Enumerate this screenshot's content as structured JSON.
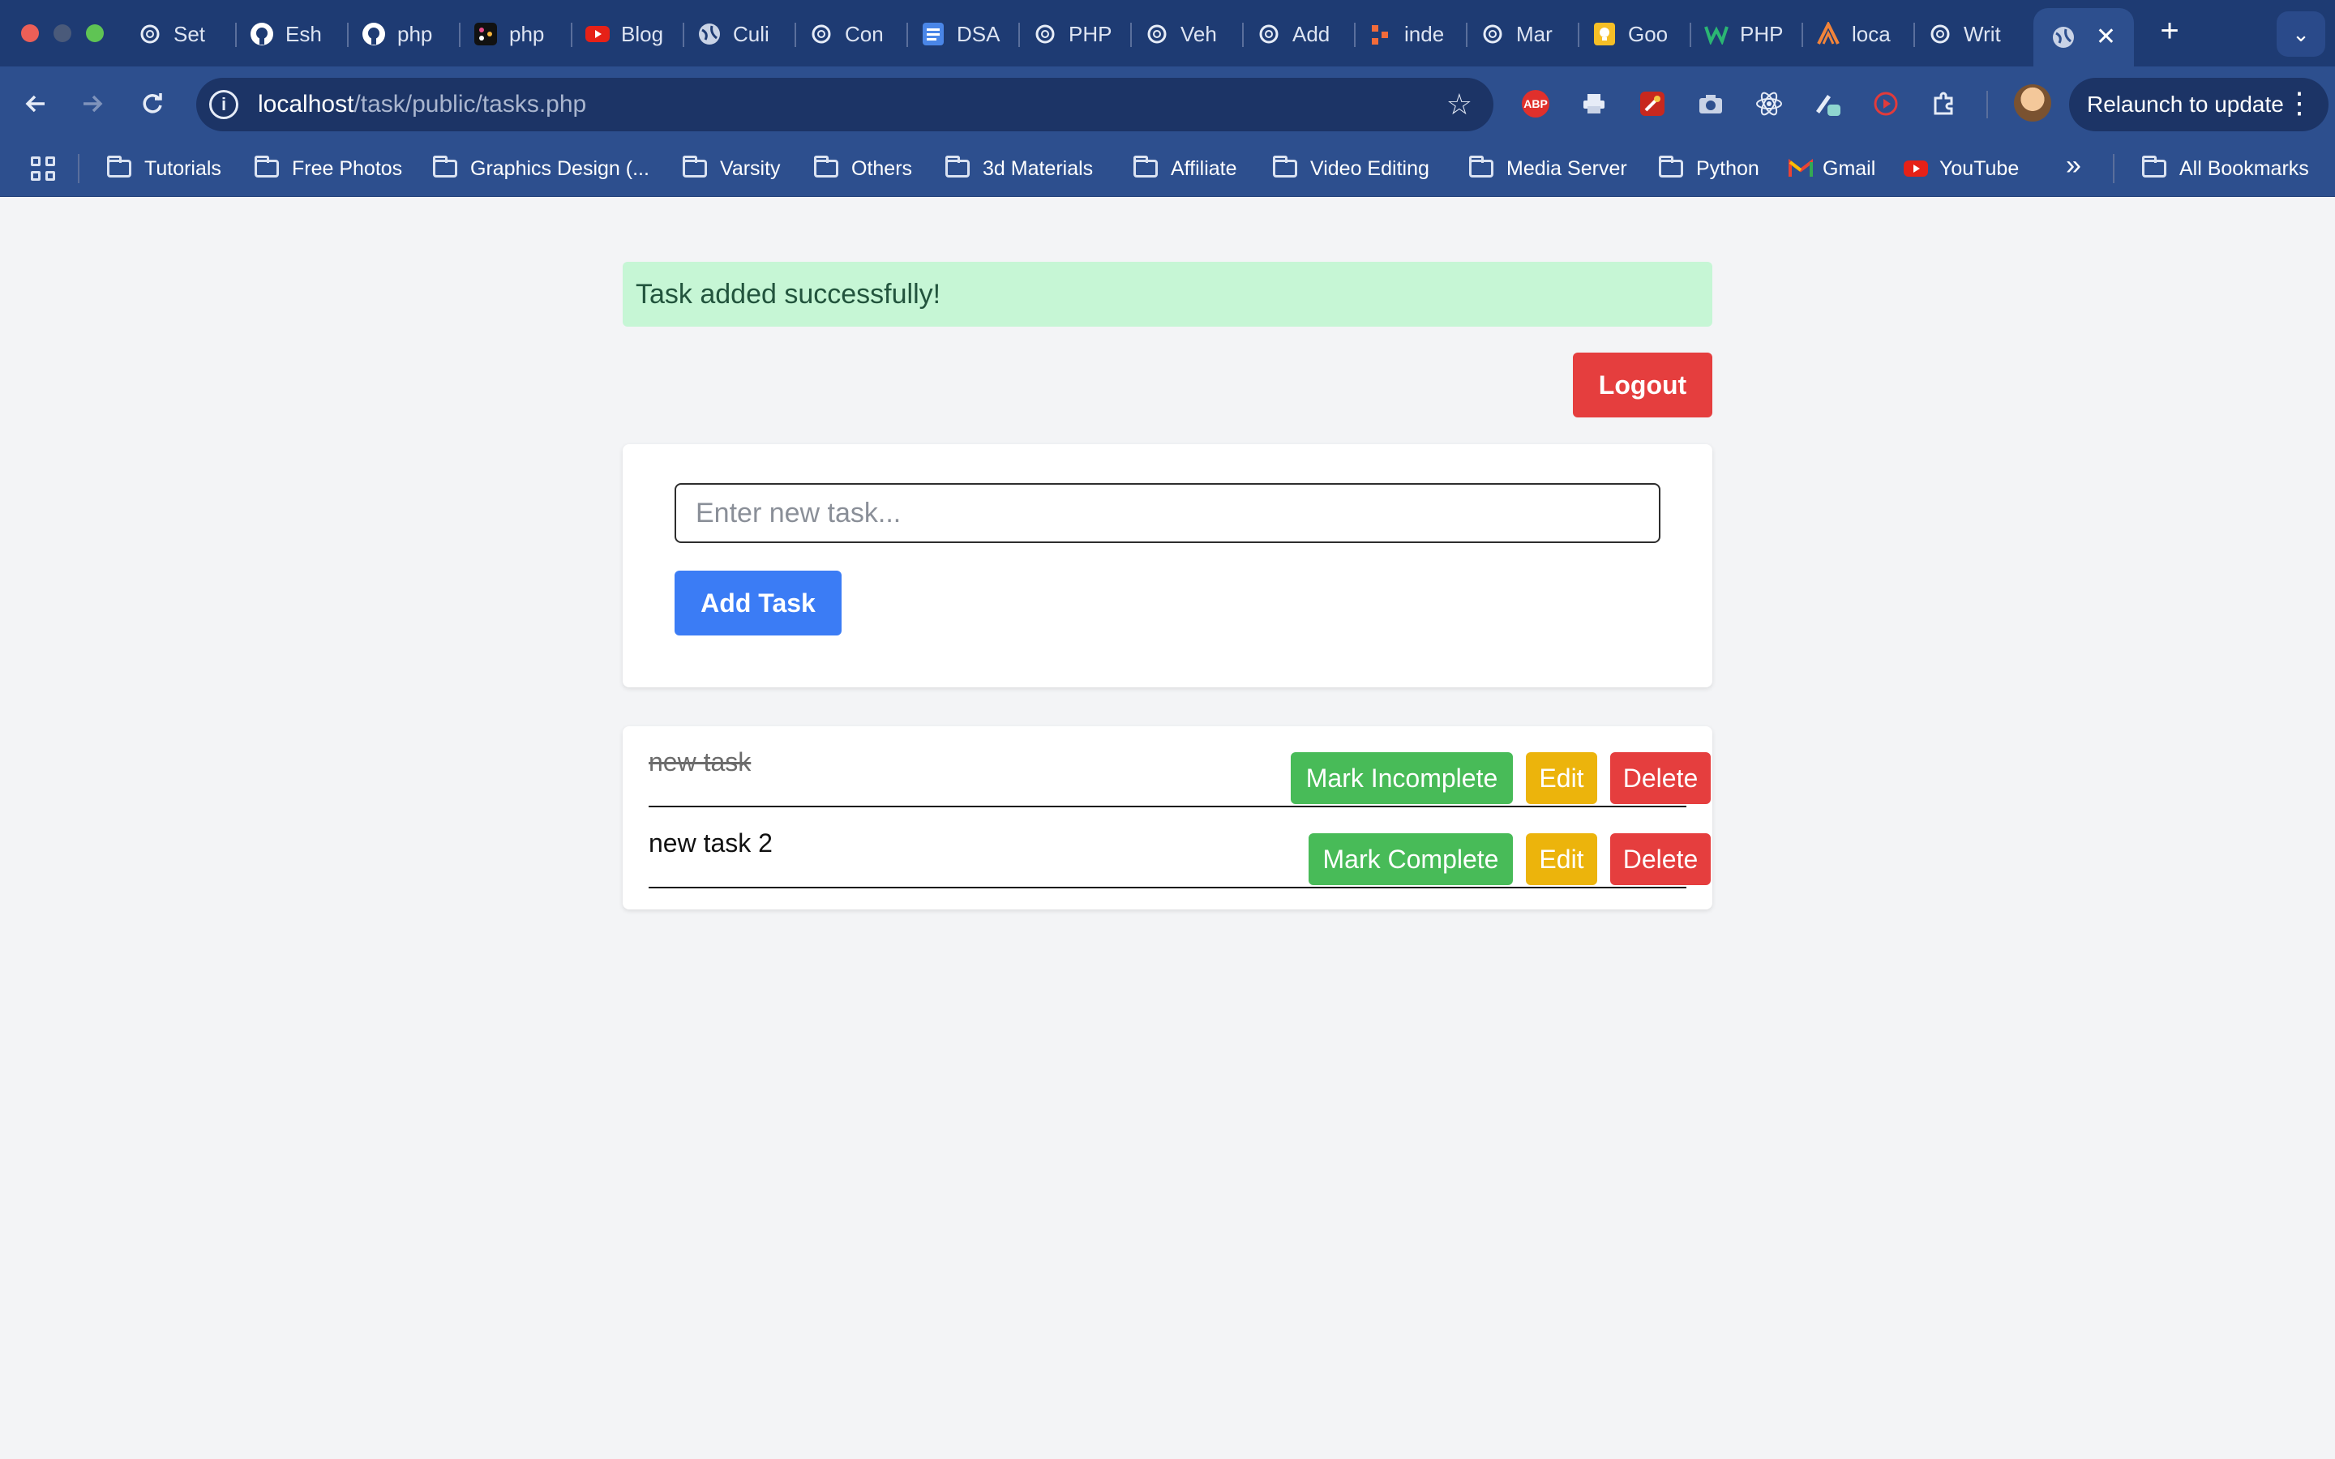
{
  "browser": {
    "tabs": [
      {
        "title": "Set",
        "icon": "openai-icon"
      },
      {
        "title": "Esh",
        "icon": "github-icon"
      },
      {
        "title": "php",
        "icon": "github-icon"
      },
      {
        "title": "php",
        "icon": "app-icon"
      },
      {
        "title": "Blog",
        "icon": "youtube-icon"
      },
      {
        "title": "Culi",
        "icon": "globe-icon"
      },
      {
        "title": "Con",
        "icon": "openai-icon"
      },
      {
        "title": "DSA",
        "icon": "docs-icon"
      },
      {
        "title": "PHP",
        "icon": "openai-icon"
      },
      {
        "title": "Veh",
        "icon": "openai-icon"
      },
      {
        "title": "Add",
        "icon": "openai-icon"
      },
      {
        "title": "inde",
        "icon": "diagram-icon"
      },
      {
        "title": "Mar",
        "icon": "openai-icon"
      },
      {
        "title": "Goo",
        "icon": "keep-icon"
      },
      {
        "title": "PHP",
        "icon": "w-icon"
      },
      {
        "title": "loca",
        "icon": "xampp-icon"
      },
      {
        "title": "Writ",
        "icon": "openai-icon"
      }
    ],
    "active_tab_icon": "globe-icon",
    "new_tab": "+",
    "url_host": "localhost",
    "url_path": "/task/public/tasks.php",
    "relaunch_label": "Relaunch to update",
    "bookmarks": [
      "Tutorials",
      "Free Photos",
      "Graphics Design (...",
      "Varsity",
      "Others",
      "3d Materials",
      "Affiliate",
      "Video Editing",
      "Media Server",
      "Python"
    ],
    "bookmark_gmail": "Gmail",
    "bookmark_youtube": "YouTube",
    "more": "»",
    "all_bookmarks": "All Bookmarks"
  },
  "page": {
    "alert_message": "Task added successfully!",
    "logout_label": "Logout",
    "task_input_placeholder": "Enter new task...",
    "add_task_label": "Add Task",
    "tasks": [
      {
        "name": "new task",
        "completed": true,
        "toggle_label": "Mark Incomplete",
        "edit_label": "Edit",
        "delete_label": "Delete"
      },
      {
        "name": "new task 2",
        "completed": false,
        "toggle_label": "Mark Complete",
        "edit_label": "Edit",
        "delete_label": "Delete"
      }
    ]
  },
  "colors": {
    "alert_bg": "#c6f6d5",
    "danger": "#e53e3e",
    "primary": "#3b7cf5",
    "success": "#48bb58",
    "warning": "#ecb40c"
  }
}
